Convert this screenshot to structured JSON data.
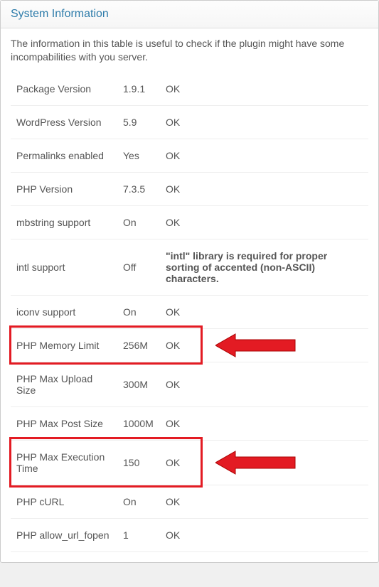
{
  "header": {
    "title": "System Information"
  },
  "description": "The information in this table is useful to check if the plugin might have some incompabilities with you server.",
  "rows": [
    {
      "label": "Package Version",
      "value": "1.9.1",
      "status": "OK",
      "bold": false
    },
    {
      "label": "WordPress Version",
      "value": "5.9",
      "status": "OK",
      "bold": false
    },
    {
      "label": "Permalinks enabled",
      "value": "Yes",
      "status": "OK",
      "bold": false
    },
    {
      "label": "PHP Version",
      "value": "7.3.5",
      "status": "OK",
      "bold": false
    },
    {
      "label": "mbstring support",
      "value": "On",
      "status": "OK",
      "bold": false
    },
    {
      "label": "intl support",
      "value": "Off",
      "status": "\"intl\" library is required for proper sorting of accented (non-ASCII) characters.",
      "bold": true
    },
    {
      "label": "iconv support",
      "value": "On",
      "status": "OK",
      "bold": false
    },
    {
      "label": "PHP Memory Limit",
      "value": "256M",
      "status": "OK",
      "bold": false
    },
    {
      "label": "PHP Max Upload Size",
      "value": "300M",
      "status": "OK",
      "bold": false
    },
    {
      "label": "PHP Max Post Size",
      "value": "1000M",
      "status": "OK",
      "bold": false
    },
    {
      "label": "PHP Max Execution Time",
      "value": "150",
      "status": "OK",
      "bold": false
    },
    {
      "label": "PHP cURL",
      "value": "On",
      "status": "OK",
      "bold": false
    },
    {
      "label": "PHP allow_url_fopen",
      "value": "1",
      "status": "OK",
      "bold": false
    }
  ],
  "annotations": {
    "highlights": [
      {
        "id": "php-memory-limit",
        "row": 7
      },
      {
        "id": "php-max-execution-time",
        "row": 10
      }
    ],
    "arrow_color": "#e31b23"
  }
}
